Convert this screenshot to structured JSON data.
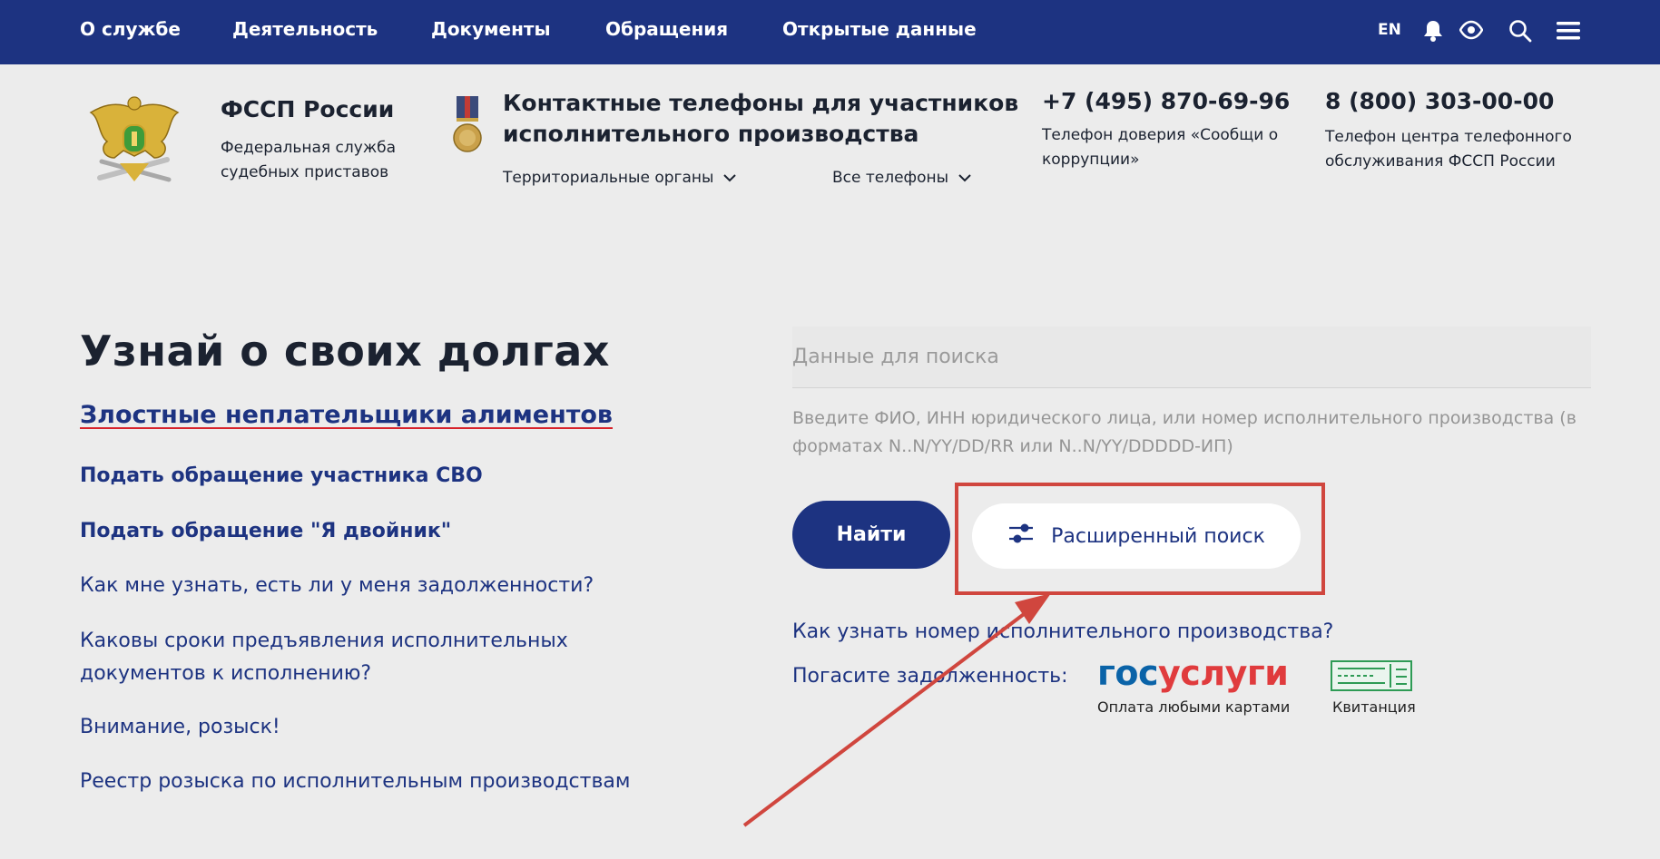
{
  "nav": {
    "items": [
      "О службе",
      "Деятельность",
      "Документы",
      "Обращения",
      "Открытые данные"
    ],
    "lang": "EN"
  },
  "header": {
    "org_name": "ФССП России",
    "org_desc": "Федеральная служба судебных приставов",
    "contacts_title": "Контактные телефоны для участников исполнительного производства",
    "dropdown_territorial": "Территориальные органы",
    "dropdown_all_phones": "Все телефоны",
    "phone1": "+7 (495) 870-69-96",
    "phone1_desc": "Телефон доверия «Сообщи о коррупции»",
    "phone2": "8 (800) 303-00-00",
    "phone2_desc": "Телефон центра телефонного обслуживания ФССП России"
  },
  "main": {
    "title": "Узнай о своих долгах",
    "featured_link": "Злостные неплательщики алиментов",
    "links": [
      "Подать обращение участника СВО",
      "Подать обращение \"Я двойник\"",
      "Как мне узнать, есть ли у меня задолженности?",
      "Каковы сроки предъявления исполнительных документов к исполнению?",
      "Внимание, розыск!",
      "Реестр розыска по исполнительным производствам"
    ]
  },
  "search": {
    "placeholder": "Данные для поиска",
    "hint": "Введите ФИО, ИНН юридического лица, или номер исполнительного производства (в форматах N..N/YY/DD/RR или N..N/YY/DDDDD-ИП)",
    "find_button": "Найти",
    "advanced_button": "Расширенный поиск",
    "help_link": "Как узнать номер исполнительного производства?",
    "pay_label": "Погасите задолженность:",
    "gosuslugi_part1": "гос",
    "gosuslugi_part2": "услуги",
    "gosuslugi_caption": "Оплата любыми картами",
    "receipt_caption": "Квитанция"
  },
  "colors": {
    "brand_blue": "#1d3381",
    "highlight_red": "#d0463e"
  }
}
